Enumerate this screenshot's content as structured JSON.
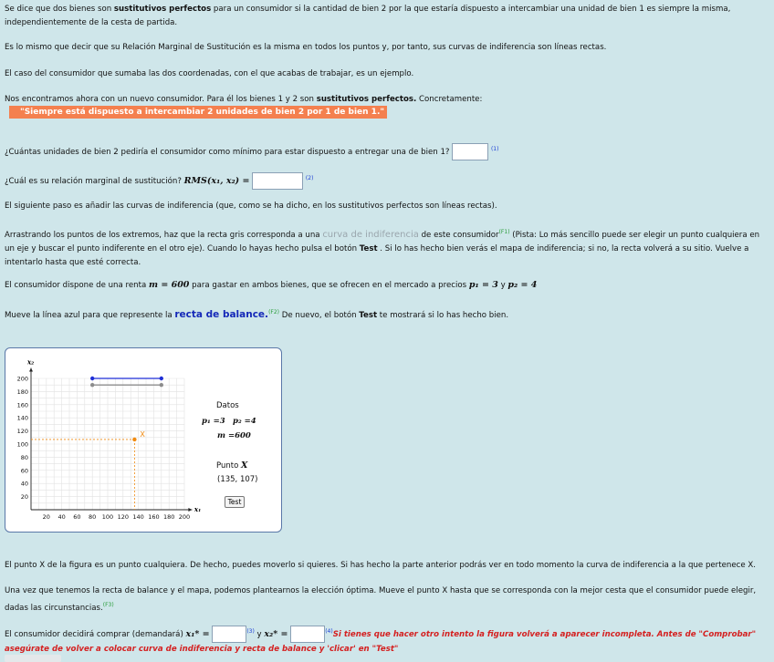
{
  "intro": {
    "p1_a": "Se dice que dos bienes son ",
    "p1_b": "sustitutivos perfectos",
    "p1_c": " para un consumidor si la cantidad de bien 2 por la que estaría dispuesto a intercambiar una unidad de bien 1 es siempre la misma, independientemente de la cesta de partida.",
    "p2": "Es lo mismo que decir que su Relación Marginal de Sustitución es la misma en todos los puntos y, por tanto, sus curvas de indiferencia son líneas rectas.",
    "p3": "El caso del consumidor que sumaba las dos coordenadas, con el que acabas de trabajar, es un ejemplo.",
    "p4_a": "Nos encontramos ahora con un nuevo consumidor. Para él los bienes 1 y 2 son ",
    "p4_b": "sustitutivos perfectos.",
    "p4_c": " Concretamente:",
    "banner": "\"Siempre está dispuesto a intercambiar 2 unidades de bien 2 por 1 de bien 1.\""
  },
  "questions": {
    "q1": "¿Cuántas unidades de bien 2 pediría el consumidor como mínimo para estar dispuesto a entregar una de bien 1?",
    "q1_ref": "(1)",
    "q2": "¿Cuál es su relación marginal de sustitución? ",
    "q2_math": "RMS(x₁, x₂) =",
    "q2_ref": "(2)"
  },
  "steps": {
    "s1": "El siguiente paso es añadir las curvas de indiferencia (que, como se ha dicho, en los sustitutivos perfectos son líneas rectas).",
    "s2_a": "Arrastrando los puntos de los extremos, haz que la recta gris corresponda a una ",
    "s2_link": "curva de indiferencia",
    "s2_b": " de este consumidor",
    "s2_f1": "(F1)",
    "s2_c": " (Pista: Lo más sencillo puede ser elegir un punto cualquiera en un eje y buscar el punto indiferente en el otro eje). Cuando lo hayas hecho pulsa el botón ",
    "s2_test": "Test",
    "s2_d": " . Si lo has hecho bien verás el mapa de indiferencia; si no, la recta volverá a su sitio. Vuelve a intentarlo hasta que esté correcta.",
    "s3_a": "El consumidor dispone de una renta ",
    "s3_m": "m = 600",
    "s3_b": " para gastar en ambos bienes, que se ofrecen en el mercado a precios ",
    "s3_p1": "p₁ = 3",
    "s3_y": " y ",
    "s3_p2": "p₂ = 4",
    "s4_a": "Mueve la línea azul para que represente la ",
    "s4_link": "recta de balance.",
    "s4_f2": "(F2)",
    "s4_b": " De nuevo, el botón ",
    "s4_test": "Test",
    "s4_c": " te mostrará si lo has hecho bien."
  },
  "applet": {
    "y_axis_label": "x₂",
    "x_axis_label": "x₁",
    "y_ticks": [
      "200",
      "180",
      "160",
      "140",
      "120",
      "100",
      "80",
      "60",
      "40",
      "20"
    ],
    "x_ticks": [
      "20",
      "40",
      "60",
      "80",
      "100",
      "120",
      "140",
      "160",
      "180",
      "200"
    ],
    "point_label": "X",
    "datos_title": "Datos",
    "p1_text": "p₁ =3",
    "p2_text": "p₂ =4",
    "m_text": "m =600",
    "punto_title": "Punto",
    "punto_x": "X",
    "punto_coords": "(135, 107)",
    "test_label": "Test",
    "blue_line_color": "#1f2fd6",
    "grey_line_color": "#8c8c8c",
    "point_color": "#f08a10",
    "point": {
      "x": 135,
      "y": 107
    },
    "blue_line": {
      "x1": 80,
      "x2": 170,
      "y": 200
    },
    "grey_line": {
      "x1": 80,
      "x2": 170,
      "y": 190
    }
  },
  "after": {
    "a1": "El punto X de la figura es un punto cualquiera. De hecho, puedes moverlo si quieres. Si has hecho la parte anterior podrás ver en todo momento la curva de indiferencia a la que pertenece X.",
    "a2": "Una vez que tenemos la recta de balance y el mapa, podemos plantearnos la elección óptima. Mueve el punto X hasta que se corresponda con la mejor cesta que el consumidor puede elegir, dadas las circunstancias.",
    "a2_f3": "(F3)",
    "a3_a": "El consumidor decidirá comprar (demandará) ",
    "a3_x1": "x₁* =",
    "a3_ref3": "(3)",
    "a3_y": " y ",
    "a3_x2": "x₂* =",
    "a3_ref4": "(4)",
    "a3_warn": "Si tienes que hacer otro intento la figura volverá a aparecer incompleta. Antes de \"Comprobar\" asegúrate de volver a colocar curva de indiferencia y recta de balance y 'clicar' en \"Test\""
  }
}
